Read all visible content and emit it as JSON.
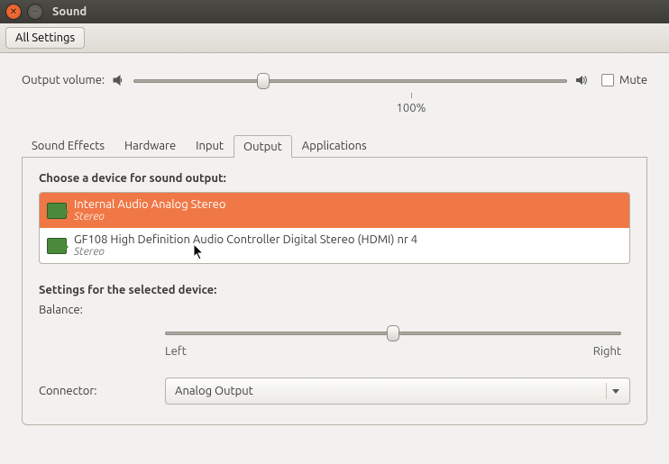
{
  "window": {
    "title": "Sound"
  },
  "toolbar": {
    "all_settings": "All Settings"
  },
  "volume": {
    "label": "Output volume:",
    "mute_label": "Mute",
    "mute_checked": false,
    "percent_mark": "100%",
    "thumb_position_pct": 30
  },
  "tabs": {
    "items": [
      {
        "label": "Sound Effects"
      },
      {
        "label": "Hardware"
      },
      {
        "label": "Input"
      },
      {
        "label": "Output"
      },
      {
        "label": "Applications"
      }
    ],
    "active_index": 3
  },
  "output": {
    "choose_title": "Choose a device for sound output:",
    "devices": [
      {
        "name": "Internal Audio Analog Stereo",
        "sub": "Stereo",
        "selected": true
      },
      {
        "name": "GF108 High Definition Audio Controller Digital Stereo (HDMI) nr 4",
        "sub": "Stereo",
        "selected": false
      }
    ],
    "settings_title": "Settings for the selected device:",
    "balance": {
      "label": "Balance:",
      "left": "Left",
      "right": "Right",
      "thumb_position_pct": 50
    },
    "connector": {
      "label": "Connector:",
      "value": "Analog Output"
    }
  }
}
